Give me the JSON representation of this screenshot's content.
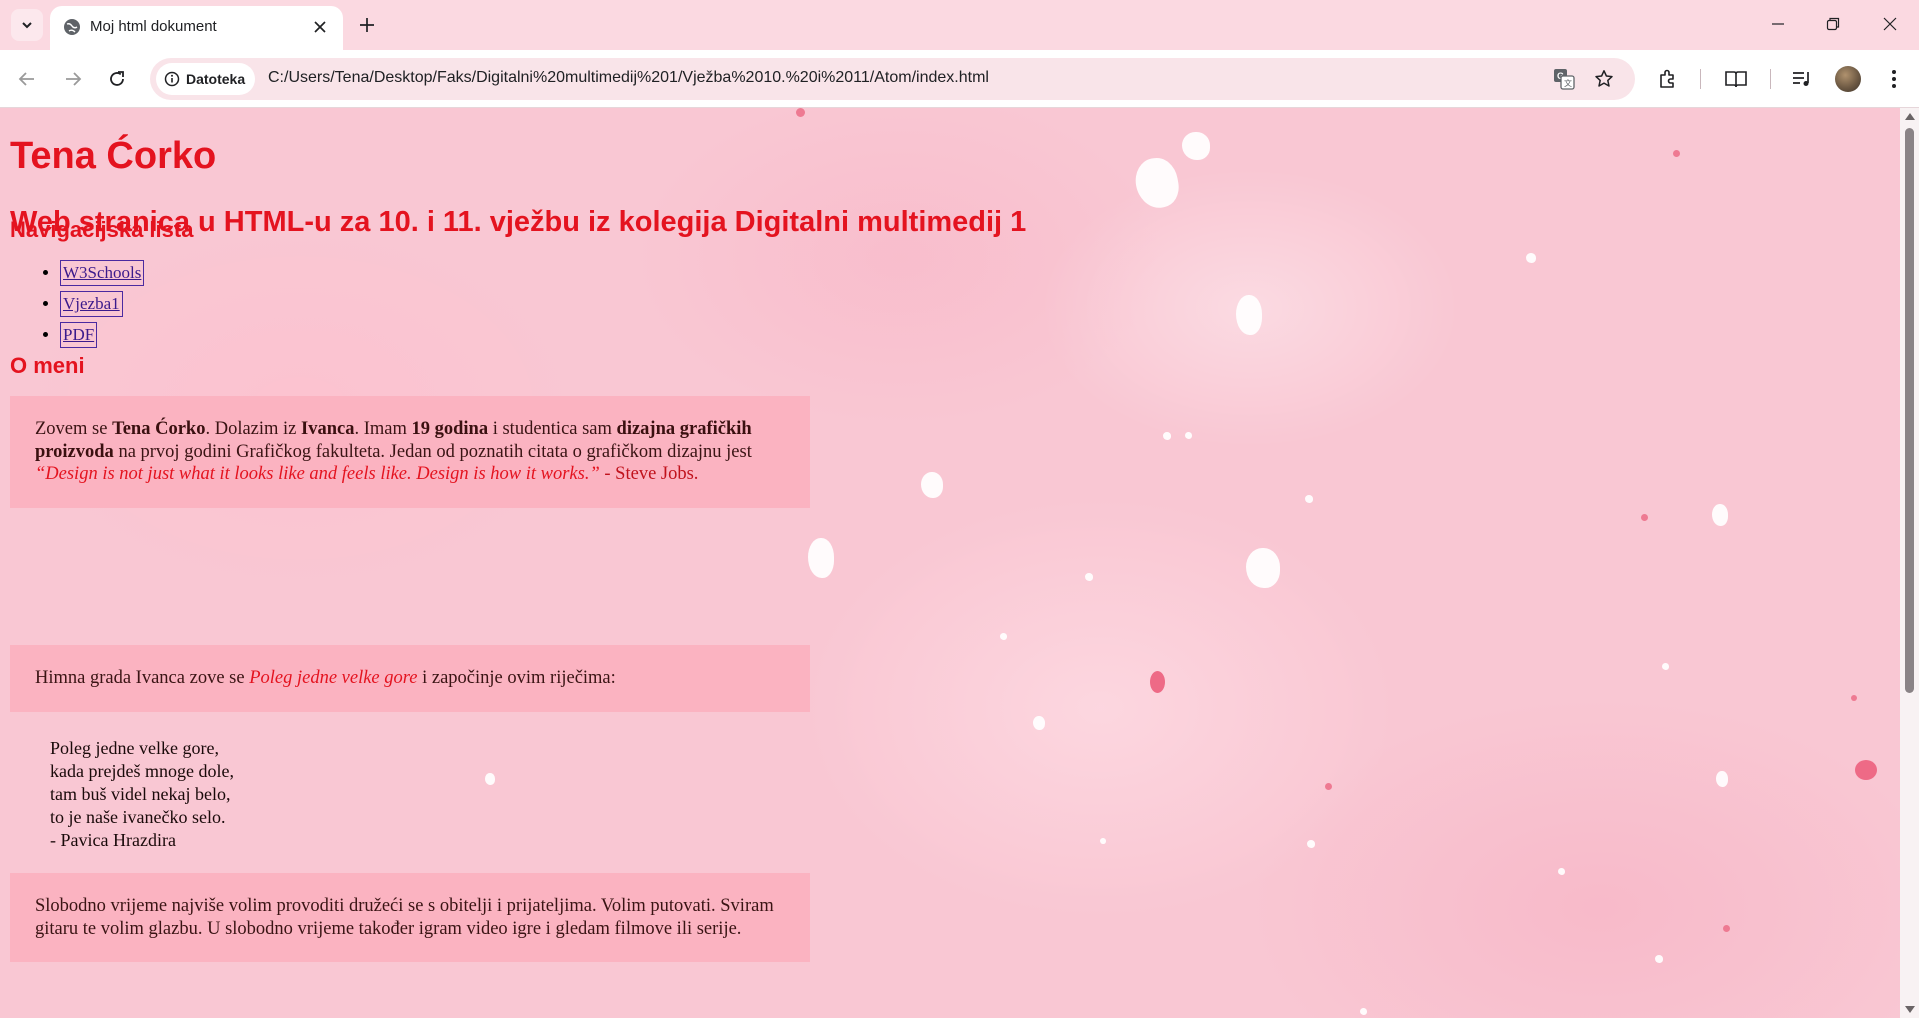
{
  "browser": {
    "tab_title": "Moj html dokument",
    "site_chip_label": "Datoteka",
    "url": "C:/Users/Tena/Desktop/Faks/Digitalni%20multimedij%201/Vježba%2010.%20i%2011/Atom/index.html",
    "icons": [
      "tab-search-icon",
      "globe-icon",
      "close-icon",
      "plus-icon",
      "minimize-icon",
      "restore-icon",
      "close-window-icon",
      "back-arrow-icon",
      "forward-arrow-icon",
      "reload-icon",
      "info-icon",
      "translate-icon",
      "star-icon",
      "extensions-icon",
      "reading-list-icon",
      "media-control-icon",
      "menu-dots-icon"
    ]
  },
  "page": {
    "name": "Tena Ćorko",
    "subtitle": "Web stranica u HTML-u za 10. i 11. vježbu iz kolegija Digitalni multimedij 1",
    "nav_heading": "Navigacijska lista",
    "nav_links": [
      "W3Schools",
      "Vjezba1",
      "PDF"
    ],
    "about_heading": "O meni",
    "about": {
      "p1_a": "Zovem se ",
      "p1_name": "Tena Ćorko",
      "p1_b": ". Dolazim iz ",
      "p1_town": "Ivanca",
      "p1_c": ". Imam ",
      "p1_age": "19 godina",
      "p1_d": " i studentica sam ",
      "p1_study": "dizajna grafičkih proizvoda",
      "p1_e": " na prvoj godini Grafičkog fakulteta. Jedan od poznatih citata o grafičkom dizajnu jest ",
      "p1_quote": "“Design is not just what it looks like and feels like. Design is how it works.”",
      "p1_author": " - Steve Jobs.",
      "p2_a": "Himna grada Ivanca zove se ",
      "p2_song": "Poleg jedne velke gore",
      "p2_b": " i započinje ovim riječima:",
      "poem": [
        "Poleg jedne velke gore,",
        "kada prejdeš mnoge dole,",
        "tam buš videl nekaj belo,",
        "to je naše ivanečko selo.",
        "- Pavica Hrazdira"
      ],
      "p3": "Slobodno vrijeme najviše volim provoditi družeći se s obitelji i prijateljima. Volim putovati. Sviram gitaru te volim glazbu. U slobodno vrijeme također igram video igre i gledam filmove ili serije."
    }
  },
  "colors": {
    "heading_red": "#e4131f",
    "box_pink": "#fbb3c1",
    "link_purple": "#3b1a8c"
  }
}
